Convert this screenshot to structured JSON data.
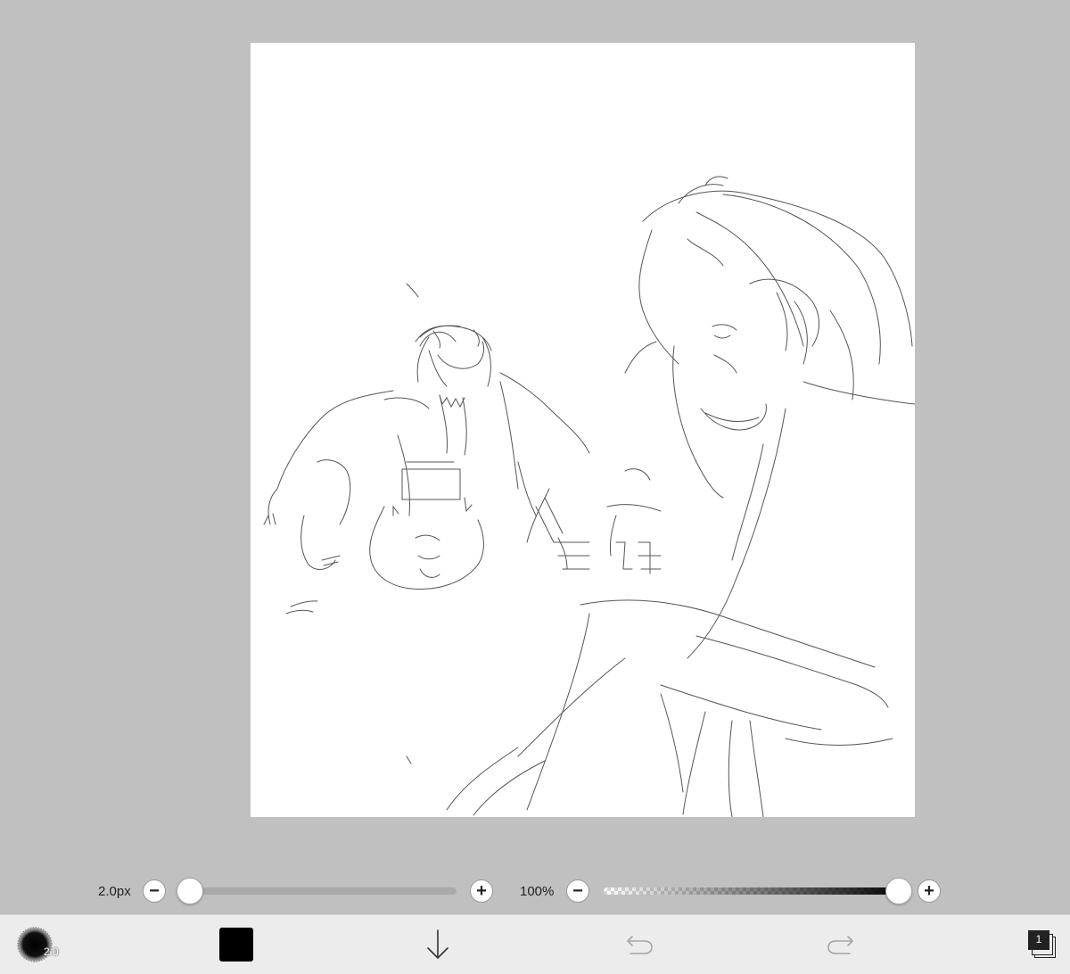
{
  "canvas": {
    "background": "#ffffff",
    "workspace_background": "#c0c0c0"
  },
  "brush_size": {
    "label": "2.0px",
    "minus": "−",
    "plus": "+",
    "value": 0.0
  },
  "opacity": {
    "label": "100%",
    "minus": "−",
    "plus": "+",
    "value": 1.0
  },
  "toolbar": {
    "brush_size_badge": "2.0",
    "color": "#000000",
    "layer_count": "1",
    "icons": [
      "brush-tip-icon",
      "color-swatch",
      "arrow-down-icon",
      "undo-icon",
      "redo-icon",
      "layers-icon"
    ]
  }
}
